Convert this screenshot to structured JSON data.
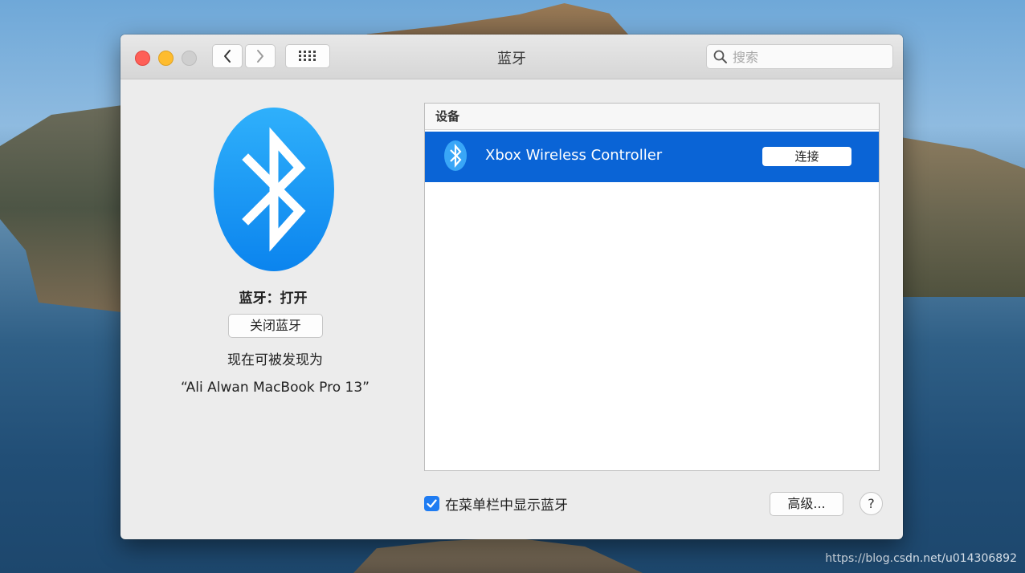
{
  "window": {
    "title": "蓝牙"
  },
  "toolbar": {
    "search_placeholder": "搜索"
  },
  "bluetooth": {
    "status": "蓝牙：打开",
    "toggle_label": "关闭蓝牙",
    "discoverable_label": "现在可被发现为",
    "device_name": "“Ali Alwan MacBook Pro 13”"
  },
  "devices": {
    "header": "设备",
    "items": [
      {
        "name": "Xbox Wireless Controller",
        "action": "连接"
      }
    ]
  },
  "footer": {
    "show_in_menubar_label": "在菜单栏中显示蓝牙",
    "show_in_menubar_checked": true,
    "advanced_label": "高级...",
    "help_label": "?"
  },
  "watermark": "https://blog.csdn.net/u014306892",
  "colors": {
    "accent": "#0a64d6",
    "bluetooth_blue": "#1a9bf5"
  },
  "icons": [
    "bluetooth-icon",
    "search-icon",
    "back-chevron-icon",
    "forward-chevron-icon",
    "grid-icon",
    "checkmark-icon"
  ]
}
